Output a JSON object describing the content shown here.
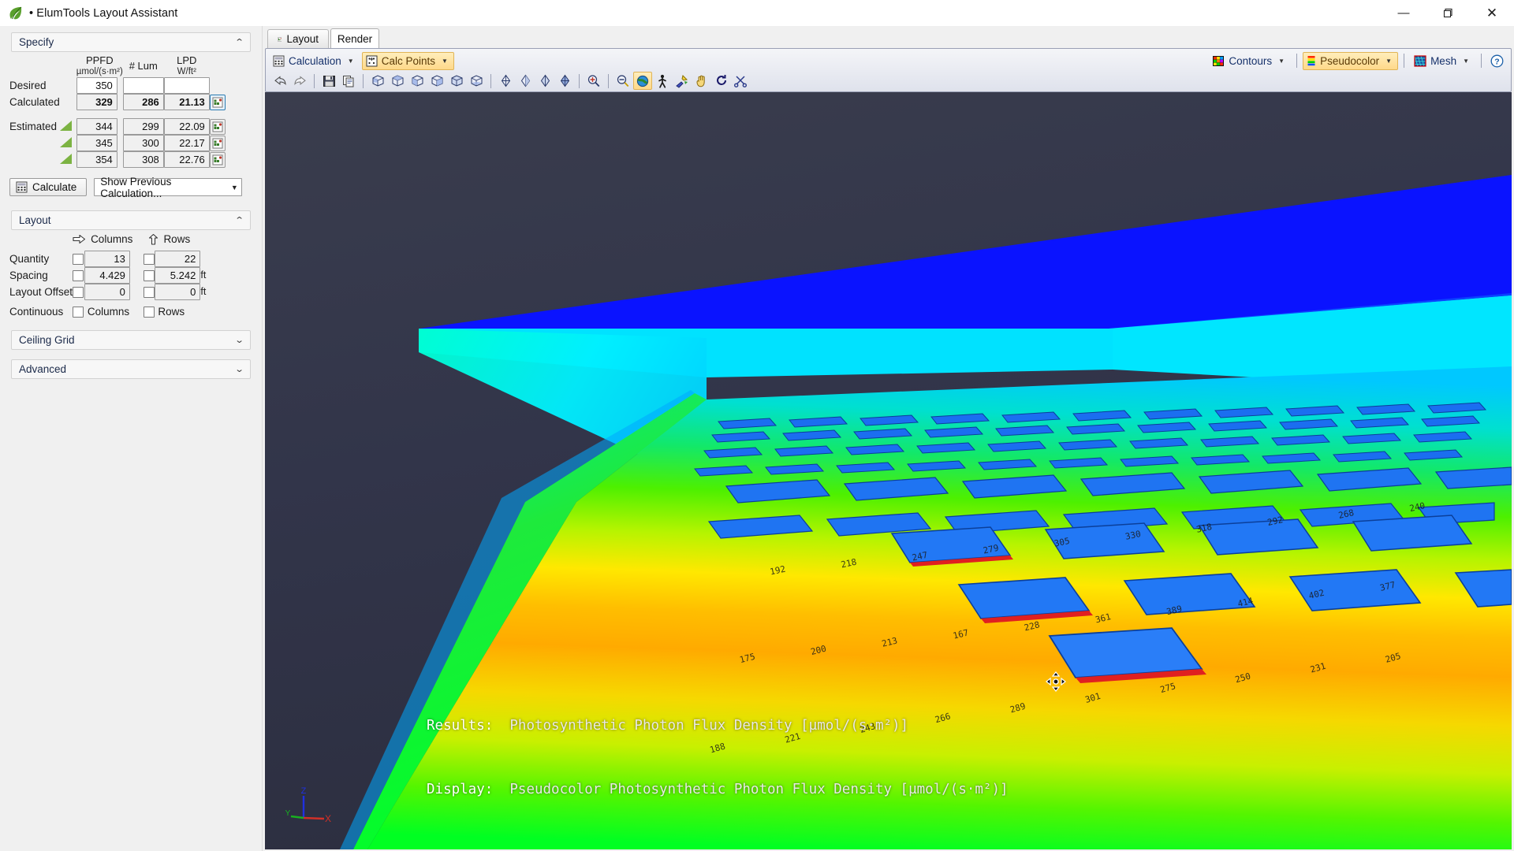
{
  "window": {
    "title": "• ElumTools Layout Assistant",
    "app_icon": "leaf-icon",
    "minimize": "—",
    "maximize": "❐",
    "close": "✕"
  },
  "sidebar": {
    "sections": [
      {
        "id": "specify",
        "label": "Specify",
        "expanded": true,
        "chevron": "⌃"
      },
      {
        "id": "layout",
        "label": "Layout",
        "expanded": true,
        "chevron": "⌃"
      },
      {
        "id": "ceiling_grid",
        "label": "Ceiling Grid",
        "expanded": false,
        "chevron": "⌄"
      },
      {
        "id": "advanced",
        "label": "Advanced",
        "expanded": false,
        "chevron": "⌄"
      }
    ],
    "specify": {
      "columns": [
        {
          "name": "PPFD",
          "unit": "µmol/(s·m²)"
        },
        {
          "name": "# Lum",
          "unit": ""
        },
        {
          "name": "LPD",
          "unit": "W/ft²"
        }
      ],
      "rows": [
        {
          "label": "Desired",
          "ppfd": "350",
          "lum": "",
          "lpd": "",
          "style": "input",
          "has_icon": false,
          "has_triangle": false
        },
        {
          "label": "Calculated",
          "ppfd": "329",
          "lum": "286",
          "lpd": "21.13",
          "style": "calculated",
          "has_icon": true,
          "icon_selected": true,
          "has_triangle": false
        },
        {
          "label": "Estimated",
          "ppfd": "344",
          "lum": "299",
          "lpd": "22.09",
          "style": "estimated",
          "has_icon": true,
          "icon_selected": false,
          "has_triangle": true
        },
        {
          "label": "",
          "ppfd": "345",
          "lum": "300",
          "lpd": "22.17",
          "style": "estimated",
          "has_icon": true,
          "icon_selected": false,
          "has_triangle": true
        },
        {
          "label": "",
          "ppfd": "354",
          "lum": "308",
          "lpd": "22.76",
          "style": "estimated",
          "has_icon": true,
          "icon_selected": false,
          "has_triangle": true
        }
      ],
      "calculate_button": "Calculate",
      "calculate_icon": "calculator-icon",
      "previous_calc_select": "Show Previous Calculation..."
    },
    "layout": {
      "col_header": "Columns",
      "row_header": "Rows",
      "col_header_icon": "arrow-right-icon",
      "row_header_icon": "arrow-up-icon",
      "rows": [
        {
          "label": "Quantity",
          "col_value": "13",
          "row_value": "22",
          "col_unit": "",
          "row_unit": "",
          "col_checked": false,
          "row_checked": false
        },
        {
          "label": "Spacing",
          "col_value": "4.429",
          "row_value": "5.242",
          "col_unit": "",
          "row_unit": "ft",
          "col_checked": false,
          "row_checked": false
        },
        {
          "label": "Layout Offset",
          "col_value": "0",
          "row_value": "0",
          "col_unit": "",
          "row_unit": "ft",
          "col_checked": false,
          "row_checked": false
        }
      ],
      "continuous_label": "Continuous",
      "continuous_columns": "Columns",
      "continuous_rows": "Rows",
      "continuous_columns_checked": false,
      "continuous_rows_checked": false
    }
  },
  "tabs": [
    {
      "id": "layout",
      "label": "Layout",
      "icon": "layout-icon",
      "active": false
    },
    {
      "id": "render",
      "label": "Render",
      "icon": "",
      "active": true
    }
  ],
  "toolbar": {
    "left_items": [
      {
        "label": "Calculation",
        "icon": "calculator-icon",
        "highlighted": false,
        "has_caret": true
      },
      {
        "label": "Calc Points",
        "icon": "calc-points-icon",
        "highlighted": true,
        "has_caret": true
      }
    ],
    "right_items": [
      {
        "label": "Contours",
        "icon": "contours-icon",
        "highlighted": false,
        "has_caret": true
      },
      {
        "label": "Pseudocolor",
        "icon": "pseudocolor-icon",
        "highlighted": true,
        "has_caret": true
      },
      {
        "label": "Mesh",
        "icon": "mesh-icon",
        "highlighted": false,
        "has_caret": true
      }
    ],
    "help_icon": "help-icon",
    "icons": [
      {
        "name": "back-arrow-icon",
        "group": 0,
        "highlighted": false
      },
      {
        "name": "forward-arrow-icon",
        "group": 0,
        "highlighted": false
      },
      {
        "name": "save-icon",
        "group": 1,
        "highlighted": false
      },
      {
        "name": "copy-icon",
        "group": 1,
        "highlighted": false
      },
      {
        "name": "view-iso-icon",
        "group": 2,
        "highlighted": false
      },
      {
        "name": "view-top-icon",
        "group": 2,
        "highlighted": false
      },
      {
        "name": "view-front-icon",
        "group": 2,
        "highlighted": false
      },
      {
        "name": "view-side-icon",
        "group": 2,
        "highlighted": false
      },
      {
        "name": "view-back-icon",
        "group": 2,
        "highlighted": false
      },
      {
        "name": "view-bottom-icon",
        "group": 2,
        "highlighted": false
      },
      {
        "name": "render-wire-icon",
        "group": 3,
        "highlighted": false
      },
      {
        "name": "render-hidden-icon",
        "group": 3,
        "highlighted": false
      },
      {
        "name": "render-shaded-icon",
        "group": 3,
        "highlighted": false
      },
      {
        "name": "render-full-icon",
        "group": 3,
        "highlighted": false
      },
      {
        "name": "zoom-out-icon",
        "group": 4,
        "highlighted": false
      },
      {
        "name": "zoom-in-icon",
        "group": 5,
        "highlighted": false
      },
      {
        "name": "globe-orbit-icon",
        "group": 5,
        "highlighted": true
      },
      {
        "name": "walk-icon",
        "group": 5,
        "highlighted": false
      },
      {
        "name": "light-probe-icon",
        "group": 5,
        "highlighted": false
      },
      {
        "name": "pan-hand-icon",
        "group": 5,
        "highlighted": false
      },
      {
        "name": "refresh-icon",
        "group": 5,
        "highlighted": false
      },
      {
        "name": "scissors-icon",
        "group": 5,
        "highlighted": false
      }
    ]
  },
  "viewport": {
    "cursor_icon": "orbit-cursor-icon",
    "axis_gizmo": {
      "x_label": "X",
      "y_label": "Y",
      "z_label": "Z",
      "x_color": "#d03028",
      "y_color": "#18b020",
      "z_color": "#2030e0"
    },
    "status": {
      "results_label": "Results:",
      "results_value": "Photosynthetic Photon Flux Density [µmol/(s·m²)]",
      "display_label": "Display:",
      "display_value": "Pseudocolor Photosynthetic Photon Flux Density [µmol/(s·m²)]"
    },
    "pseudocolor_scale": [
      "#0000ff",
      "#00c8ff",
      "#00ff88",
      "#66ff00",
      "#ffff00",
      "#ffa000",
      "#ff2000"
    ],
    "calc_point_values": [
      "175",
      "200",
      "213",
      "167",
      "228",
      "361",
      "389",
      "414",
      "402",
      "377",
      "188",
      "221",
      "243",
      "266",
      "289",
      "301",
      "275",
      "250",
      "231",
      "205",
      "192",
      "218",
      "247",
      "279",
      "305",
      "330",
      "318",
      "292",
      "268",
      "240"
    ]
  },
  "colors": {
    "accent": "#ffd98a",
    "panel_bg": "#f0f0f0",
    "toolbar_bg": "#dfe2ec",
    "viewport_bg": "#2b2d3a",
    "triangle_green": "#7cb342"
  }
}
